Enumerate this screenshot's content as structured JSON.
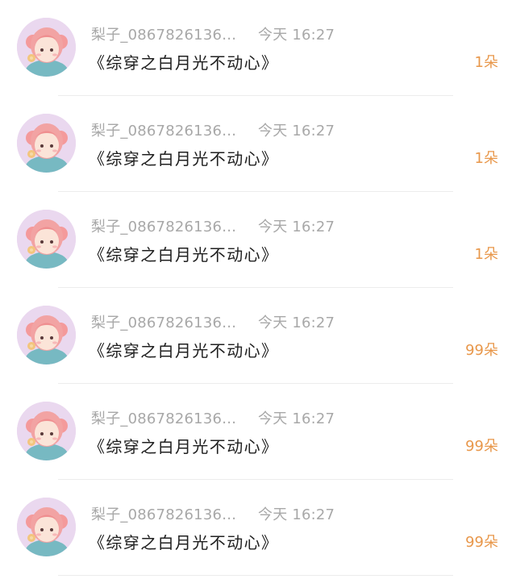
{
  "messages": [
    {
      "sender": "梨子_08678261369…",
      "time": "今天 16:27",
      "title": "《综穿之白月光不动心》",
      "count": "1朵"
    },
    {
      "sender": "梨子_08678261369…",
      "time": "今天 16:27",
      "title": "《综穿之白月光不动心》",
      "count": "1朵"
    },
    {
      "sender": "梨子_08678261369…",
      "time": "今天 16:27",
      "title": "《综穿之白月光不动心》",
      "count": "1朵"
    },
    {
      "sender": "梨子_08678261369…",
      "time": "今天 16:27",
      "title": "《综穿之白月光不动心》",
      "count": "99朵"
    },
    {
      "sender": "梨子_08678261369…",
      "time": "今天 16:27",
      "title": "《综穿之白月光不动心》",
      "count": "99朵"
    },
    {
      "sender": "梨子_08678261369…",
      "time": "今天 16:27",
      "title": "《综穿之白月光不动心》",
      "count": "99朵"
    }
  ],
  "colors": {
    "background": "#ffffff",
    "meta_text": "#a8a8a8",
    "title_text": "#202020",
    "count_text": "#e8974a",
    "divider": "#ececec",
    "avatar_background": "#ead8ef"
  },
  "avatar_icon": "girl-avatar-icon"
}
